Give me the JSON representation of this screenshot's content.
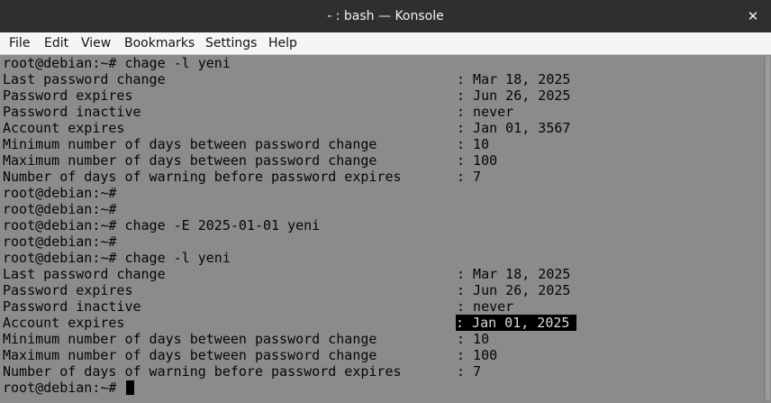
{
  "window": {
    "title": "- : bash — Konsole",
    "close_glyph": "✕"
  },
  "menu": [
    "File",
    "Edit",
    "View",
    "Bookmarks",
    "Settings",
    "Help"
  ],
  "colors": {
    "titlebar": "#2d2f31",
    "menubar": "#f5f5f5",
    "terminal_bg": "#8a8b8d",
    "terminal_fg": "#060606",
    "highlight_bg": "#000000"
  },
  "terminal": {
    "lines": [
      {
        "text": "root@debian:~# chage -l yeni",
        "value": ""
      },
      {
        "text": "Last password change",
        "value": ": Mar 18, 2025"
      },
      {
        "text": "Password expires",
        "value": ": Jun 26, 2025"
      },
      {
        "text": "Password inactive",
        "value": ": never"
      },
      {
        "text": "Account expires",
        "value": ": Jan 01, 3567"
      },
      {
        "text": "Minimum number of days between password change",
        "value": ": 10"
      },
      {
        "text": "Maximum number of days between password change",
        "value": ": 100"
      },
      {
        "text": "Number of days of warning before password expires",
        "value": ": 7"
      },
      {
        "text": "root@debian:~#",
        "value": ""
      },
      {
        "text": "root@debian:~#",
        "value": ""
      },
      {
        "text": "root@debian:~# chage -E 2025-01-01 yeni",
        "value": ""
      },
      {
        "text": "root@debian:~#",
        "value": ""
      },
      {
        "text": "root@debian:~# chage -l yeni",
        "value": ""
      },
      {
        "text": "Last password change",
        "value": ": Mar 18, 2025"
      },
      {
        "text": "Password expires",
        "value": ": Jun 26, 2025"
      },
      {
        "text": "Password inactive",
        "value": ": never"
      },
      {
        "text": "Account expires",
        "value": ": Jan 01, 2025",
        "highlight": true
      },
      {
        "text": "Minimum number of days between password change",
        "value": ": 10"
      },
      {
        "text": "Maximum number of days between password change",
        "value": ": 100"
      },
      {
        "text": "Number of days of warning before password expires",
        "value": ": 7"
      },
      {
        "text": "root@debian:~# ",
        "value": "",
        "cursor": true
      }
    ]
  }
}
